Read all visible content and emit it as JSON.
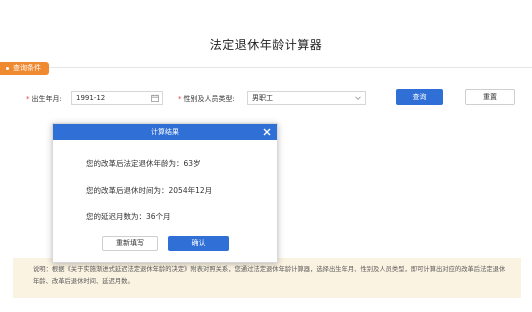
{
  "page": {
    "title": "法定退休年龄计算器"
  },
  "query_section": {
    "tab_label": "查询条件",
    "birth_label": "出生年月:",
    "birth_value": "1991-12",
    "type_label": "性别及人员类型:",
    "type_value": "男职工",
    "search_button": "查询",
    "reset_button": "重置"
  },
  "notice": {
    "text": "说明：根据《关于实施渐进式延迟法定退休年龄的决定》附表对照关系，您通过法定退休年龄计算器，选择出生年月、性别及人员类型，即可计算出对应的改革后法定退休年龄、改革后退休时间、延迟月数。"
  },
  "dialog": {
    "title": "计算结果",
    "line_age": "您的改革后法定退休年龄为：63岁",
    "line_time": "您的改革后退休时间为：2054年12月",
    "line_months": "您的延迟月数为：36个月",
    "refill_button": "重新填写",
    "confirm_button": "确认"
  },
  "icons": {
    "calendar": "calendar-icon",
    "dropdown": "chevron-down-icon",
    "close": "close-icon"
  },
  "colors": {
    "accent": "#2f6fd6",
    "tab": "#f08a30",
    "notice_bg": "#fbf3e2"
  }
}
